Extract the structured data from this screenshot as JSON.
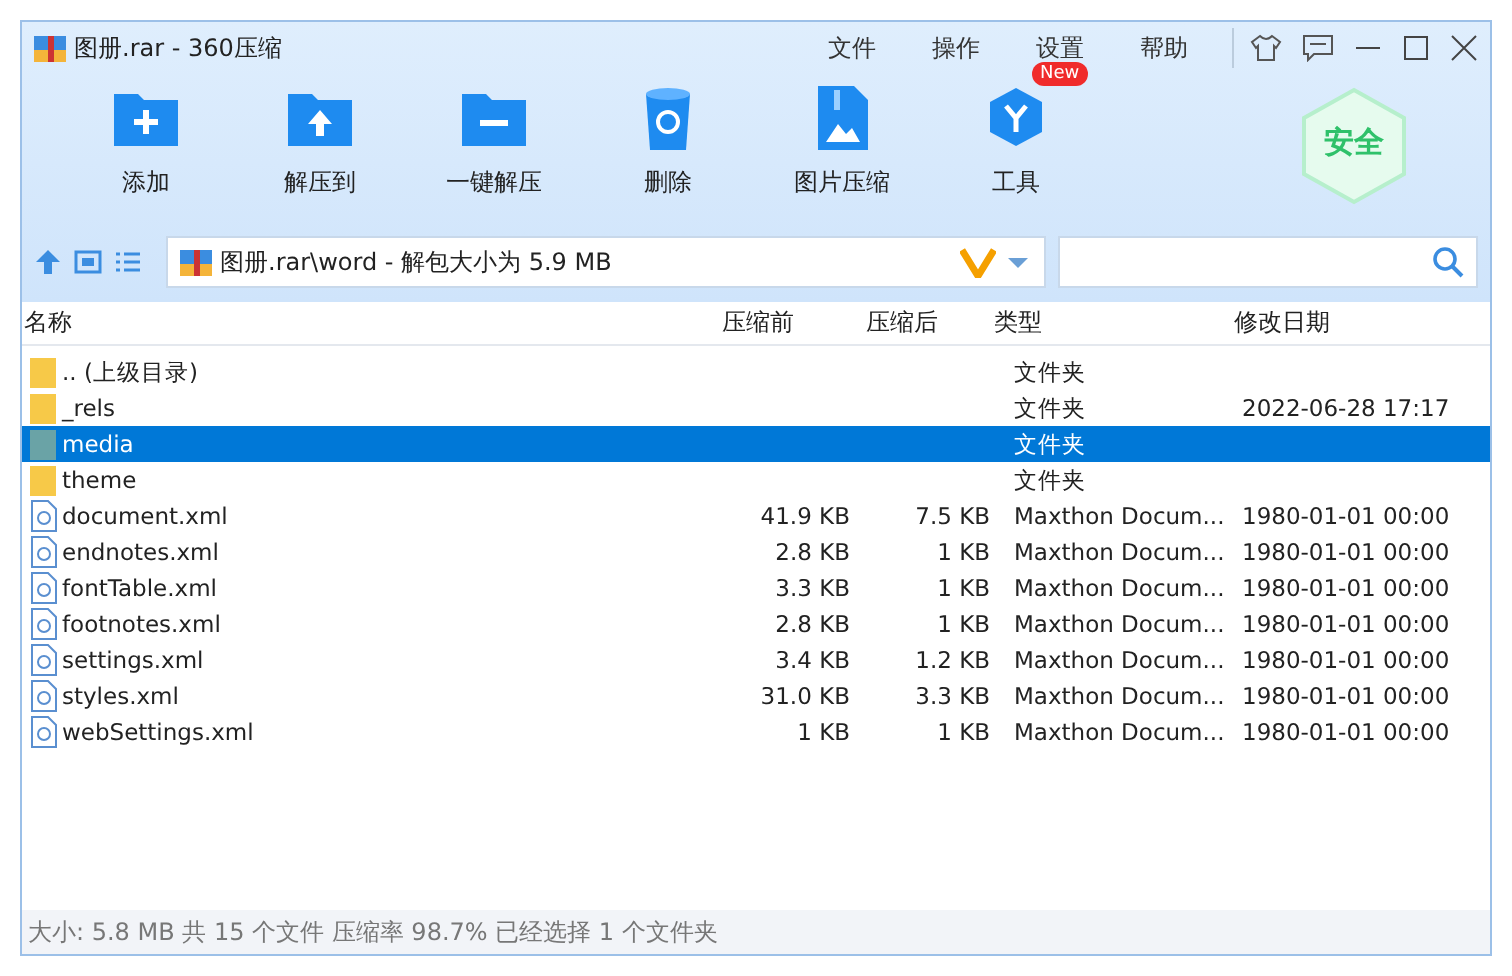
{
  "window": {
    "title": "图册.rar - 360压缩"
  },
  "menu": [
    "文件",
    "操作",
    "设置",
    "帮助"
  ],
  "toolbar": [
    {
      "kind": "add",
      "label": "添加"
    },
    {
      "kind": "extract",
      "label": "解压到"
    },
    {
      "kind": "oneclick",
      "label": "一键解压"
    },
    {
      "kind": "delete",
      "label": "删除"
    },
    {
      "kind": "image",
      "label": "图片压缩"
    },
    {
      "kind": "tools",
      "label": "工具",
      "badge": "New"
    }
  ],
  "security": {
    "label": "安全"
  },
  "address": {
    "path": "图册.rar\\word - 解包大小为 5.9 MB"
  },
  "table": {
    "columns": [
      "名称",
      "压缩前",
      "压缩后",
      "类型",
      "修改日期"
    ],
    "rows": [
      {
        "kind": "folder",
        "name": ".. (上级目录)",
        "type": "文件夹",
        "selected": false
      },
      {
        "kind": "folder",
        "name": "_rels",
        "type": "文件夹",
        "modified": "2022-06-28 17:17",
        "selected": false
      },
      {
        "kind": "folder",
        "name": "media",
        "type": "文件夹",
        "selected": true
      },
      {
        "kind": "folder",
        "name": "theme",
        "type": "文件夹",
        "selected": false
      },
      {
        "kind": "file",
        "name": "document.xml",
        "size": "41.9 KB",
        "packed": "7.5 KB",
        "type": "Maxthon Docum...",
        "modified": "1980-01-01 00:00",
        "selected": false
      },
      {
        "kind": "file",
        "name": "endnotes.xml",
        "size": "2.8 KB",
        "packed": "1 KB",
        "type": "Maxthon Docum...",
        "modified": "1980-01-01 00:00",
        "selected": false
      },
      {
        "kind": "file",
        "name": "fontTable.xml",
        "size": "3.3 KB",
        "packed": "1 KB",
        "type": "Maxthon Docum...",
        "modified": "1980-01-01 00:00",
        "selected": false
      },
      {
        "kind": "file",
        "name": "footnotes.xml",
        "size": "2.8 KB",
        "packed": "1 KB",
        "type": "Maxthon Docum...",
        "modified": "1980-01-01 00:00",
        "selected": false
      },
      {
        "kind": "file",
        "name": "settings.xml",
        "size": "3.4 KB",
        "packed": "1.2 KB",
        "type": "Maxthon Docum...",
        "modified": "1980-01-01 00:00",
        "selected": false
      },
      {
        "kind": "file",
        "name": "styles.xml",
        "size": "31.0 KB",
        "packed": "3.3 KB",
        "type": "Maxthon Docum...",
        "modified": "1980-01-01 00:00",
        "selected": false
      },
      {
        "kind": "file",
        "name": "webSettings.xml",
        "size": "1 KB",
        "packed": "1 KB",
        "type": "Maxthon Docum...",
        "modified": "1980-01-01 00:00",
        "selected": false
      }
    ]
  },
  "status_bar": "大小: 5.8 MB 共 15 个文件 压缩率 98.7% 已经选择 1 个文件夹"
}
